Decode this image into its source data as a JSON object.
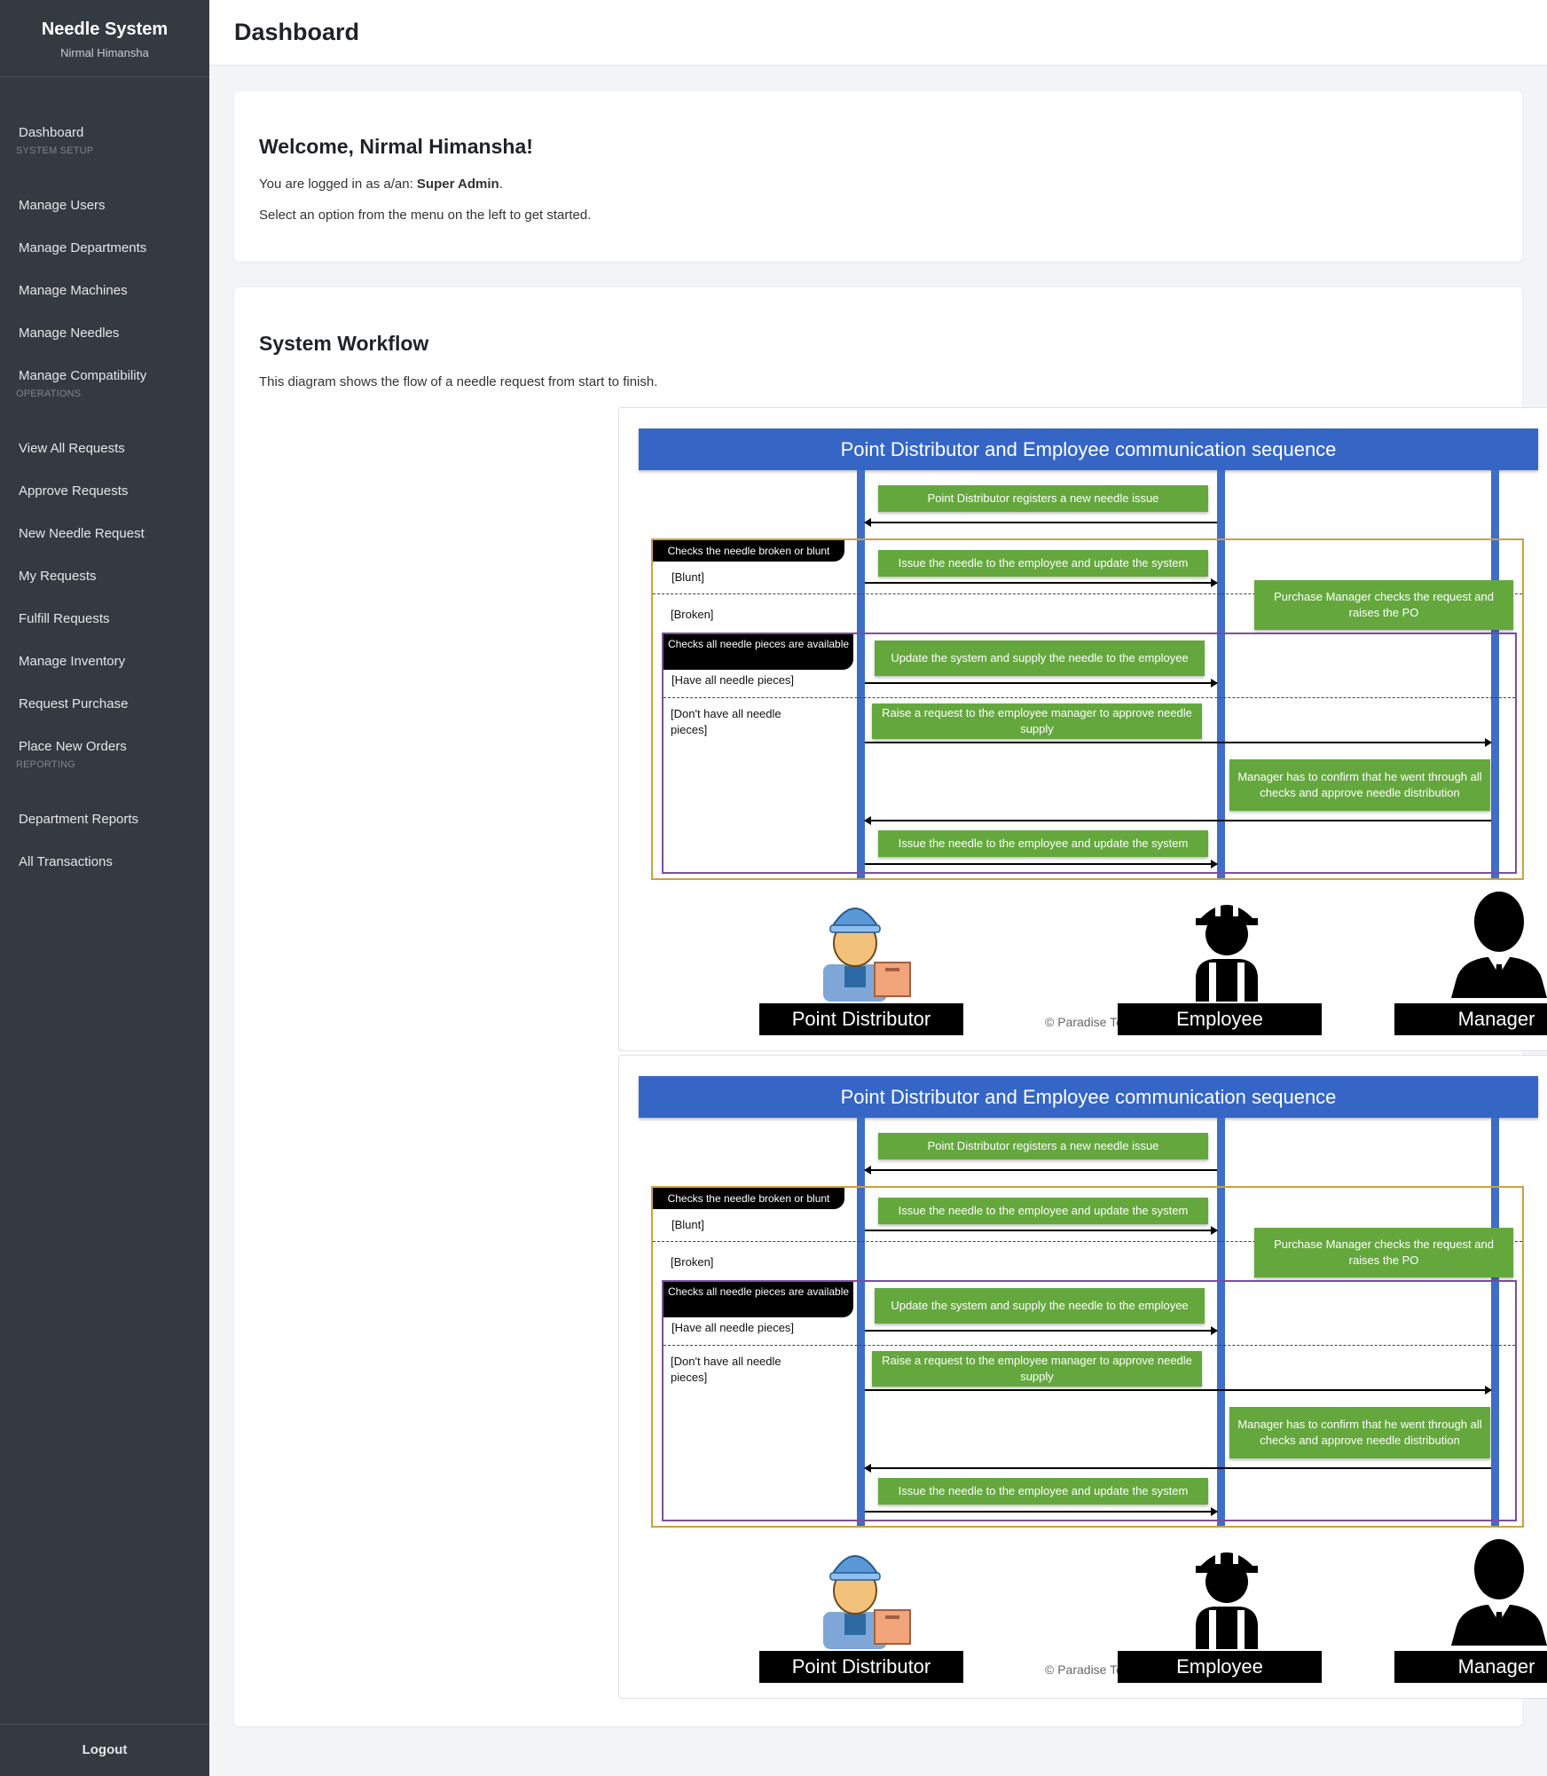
{
  "app": {
    "title": "Needle System",
    "user": "Nirmal Himansha"
  },
  "sidebar": {
    "items": [
      {
        "label": "Dashboard"
      },
      {
        "section": "SYSTEM SETUP"
      },
      {
        "label": "Manage Users"
      },
      {
        "label": "Manage Departments"
      },
      {
        "label": "Manage Machines"
      },
      {
        "label": "Manage Needles"
      },
      {
        "label": "Manage Compatibility"
      },
      {
        "section": "OPERATIONS"
      },
      {
        "label": "View All Requests"
      },
      {
        "label": "Approve Requests"
      },
      {
        "label": "New Needle Request"
      },
      {
        "label": "My Requests"
      },
      {
        "label": "Fulfill Requests"
      },
      {
        "label": "Manage Inventory"
      },
      {
        "label": "Request Purchase"
      },
      {
        "label": "Place New Orders"
      },
      {
        "section": "REPORTING"
      },
      {
        "label": "Department Reports"
      },
      {
        "label": "All Transactions"
      }
    ],
    "logout": "Logout"
  },
  "header": {
    "title": "Dashboard"
  },
  "welcome": {
    "title": "Welcome, Nirmal Himansha!",
    "role_prefix": "You are logged in as a/an: ",
    "role": "Super Admin",
    "role_suffix": ".",
    "instruction": "Select an option from the menu on the left to get started."
  },
  "workflow": {
    "title": "System Workflow",
    "description": "This diagram shows the flow of a needle request from start to finish.",
    "diagram": {
      "title": "Point Distributor and Employee communication sequence",
      "outer_frame": "Checks the needle broken or blunt",
      "inner_frame": "Checks all needle pieces are available",
      "guards": {
        "blunt": "[Blunt]",
        "broken": "[Broken]",
        "have": "[Have all needle pieces]",
        "dont_have": "[Don't have all needle pieces]"
      },
      "messages": {
        "m1": "Point Distributor registers a new needle issue",
        "m2": "Issue the needle to the employee and update the system",
        "m3": "Purchase Manager checks the request and raises the PO",
        "m4": "Update the system and supply the needle to the employee",
        "m5": "Raise a request to the employee manager to approve needle supply",
        "m6": "Manager has to confirm that he went through all checks and approve needle distribution",
        "m7": "Issue the needle to the employee and update the system"
      },
      "actors": {
        "distributor": "Point Distributor",
        "employee": "Employee",
        "manager": "Manager"
      },
      "copyright": "© Paradise Toys"
    }
  }
}
